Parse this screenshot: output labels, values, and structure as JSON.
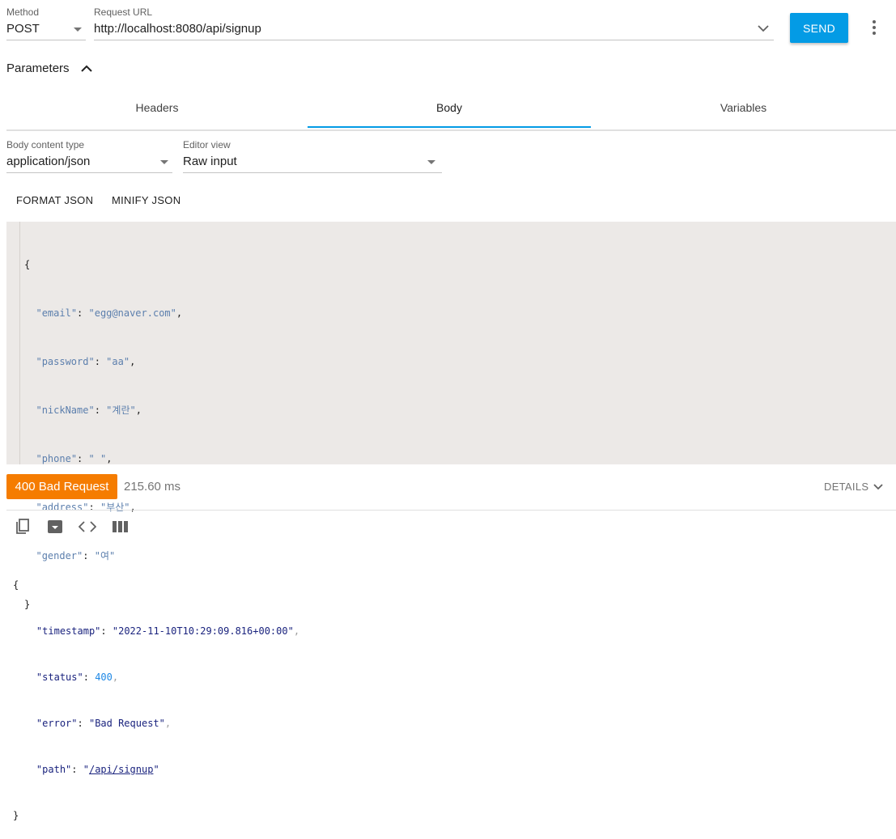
{
  "request": {
    "method_label": "Method",
    "method_value": "POST",
    "url_label": "Request URL",
    "url_value": "http://localhost:8080/api/signup",
    "send_label": "SEND"
  },
  "parameters": {
    "title": "Parameters"
  },
  "tabs": [
    {
      "label": "Headers",
      "active": false
    },
    {
      "label": "Body",
      "active": true
    },
    {
      "label": "Variables",
      "active": false
    }
  ],
  "body": {
    "content_type_label": "Body content type",
    "content_type_value": "application/json",
    "editor_view_label": "Editor view",
    "editor_view_value": "Raw input",
    "format_json": "FORMAT JSON",
    "minify_json": "MINIFY JSON",
    "json_lines": [
      {
        "key": "email",
        "value": "egg@naver.com",
        "comma": ","
      },
      {
        "key": "password",
        "value": "aa",
        "comma": ","
      },
      {
        "key": "nickName",
        "value": "계란",
        "comma": ","
      },
      {
        "key": "phone",
        "value": " ",
        "comma": ","
      },
      {
        "key": "address",
        "value": "부산",
        "comma": ","
      },
      {
        "key": "gender",
        "value": "여",
        "comma": ""
      }
    ]
  },
  "response": {
    "status": "400 Bad Request",
    "time": "215.60 ms",
    "details": "DETAILS",
    "fields": {
      "timestamp_key": "timestamp",
      "timestamp_value": "2022-11-10T10:29:09.816+00:00",
      "status_key": "status",
      "status_value": "400",
      "error_key": "error",
      "error_value": "Bad Request",
      "path_key": "path",
      "path_value": "/api/signup"
    }
  },
  "colors": {
    "accent": "#039be5",
    "status_badge": "#f57c00",
    "editor_bg": "#ece9e7"
  },
  "icons": [
    "chevron-down-icon",
    "more-vert-icon",
    "chevron-up-icon",
    "copy-icon",
    "save-icon",
    "code-icon",
    "columns-icon"
  ]
}
